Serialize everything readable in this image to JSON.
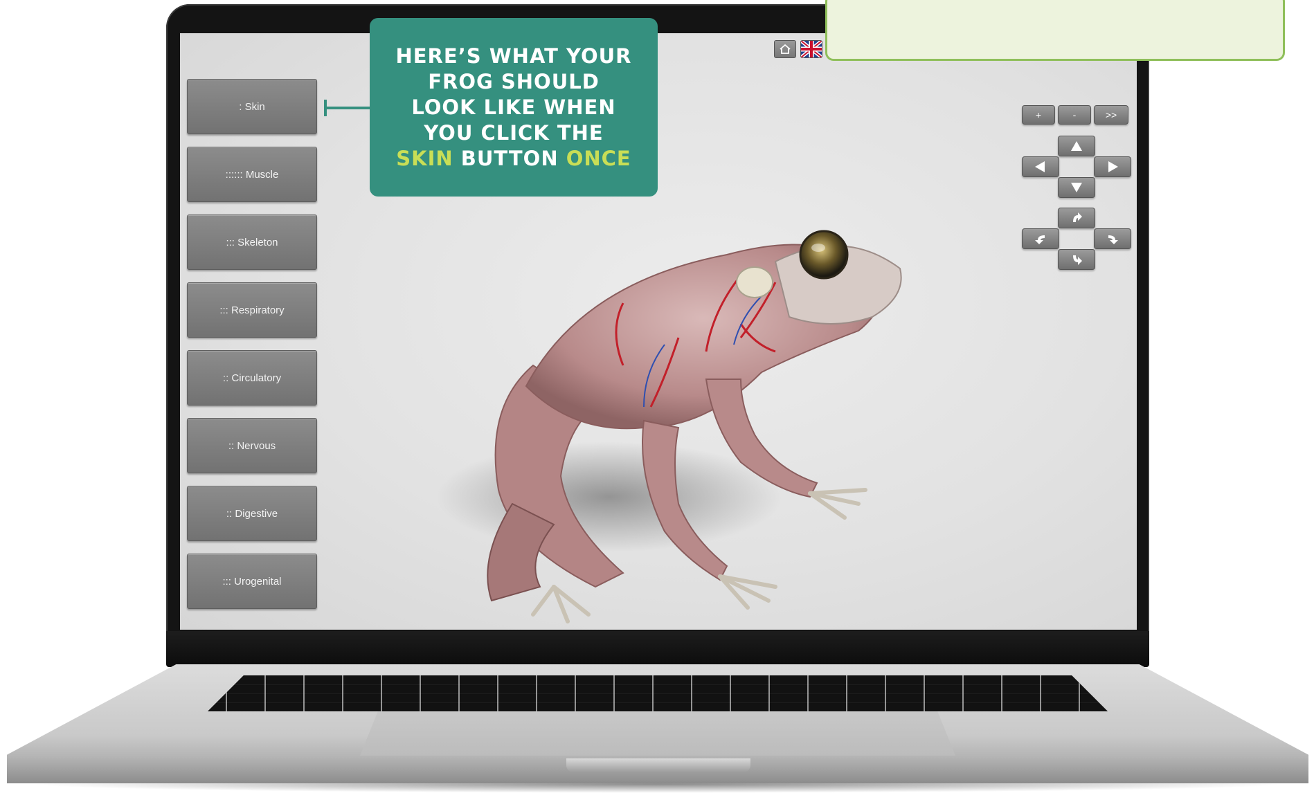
{
  "sidebar": {
    "buttons": [
      {
        "label": ": Skin"
      },
      {
        "label": ":::::: Muscle"
      },
      {
        "label": "::: Skeleton"
      },
      {
        "label": "::: Respiratory"
      },
      {
        "label": ":: Circulatory"
      },
      {
        "label": ":: Nervous"
      },
      {
        "label": ":: Digestive"
      },
      {
        "label": "::: Urogenital"
      }
    ]
  },
  "top_bar": {
    "home_icon": "home-icon",
    "language_icon": "uk-flag-icon"
  },
  "view_controls": {
    "zoom_in": "+",
    "zoom_out": "-",
    "next": ">>",
    "pan_icons": [
      "arrow-up-icon",
      "arrow-left-icon",
      "arrow-right-icon",
      "arrow-down-icon"
    ],
    "rotate_icons": [
      "rotate-up-icon",
      "rotate-left-icon",
      "rotate-right-icon",
      "rotate-down-icon"
    ]
  },
  "callout": {
    "line1": "HERE’S WHAT YOUR",
    "line2": "FROG SHOULD",
    "line3": "LOOK LIKE WHEN",
    "line4": "YOU CLICK THE",
    "highlight1": "SKIN",
    "middle": " BUTTON ",
    "highlight2": "ONCE"
  },
  "colors": {
    "callout_bg": "#35907f",
    "callout_highlight": "#c9de56",
    "note_bg": "#edf3dd",
    "note_border": "#8fbf5a"
  }
}
